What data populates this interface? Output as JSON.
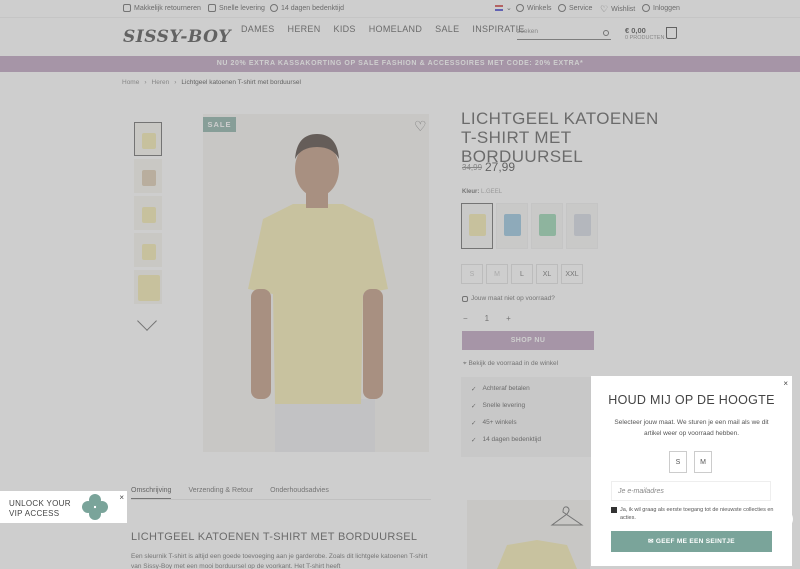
{
  "topbar": {
    "returns": "Makkelijk retourneren",
    "delivery": "Snelle levering",
    "reflection": "14 dagen bedenktijd",
    "stores": "Winkels",
    "service": "Service",
    "wishlist": "Wishlist",
    "login": "Inloggen"
  },
  "header": {
    "logo": "SISSY-BOY",
    "nav": [
      "DAMES",
      "HEREN",
      "KIDS",
      "HOMELAND",
      "SALE",
      "INSPIRATIE"
    ],
    "search_placeholder": "zoeken",
    "cart_price": "€ 0,00",
    "cart_sub": "0 PRODUCTEN"
  },
  "banner": "NU 20% EXTRA KASSAKORTING OP SALE FASHION & ACCESSOIRES MET CODE: 20% EXTRA*",
  "breadcrumb": [
    "Home",
    "Heren",
    "Lichtgeel katoenen T-shirt met borduursel"
  ],
  "product": {
    "sale_badge": "SALE",
    "title": "LICHTGEEL KATOENEN T-SHIRT MET BORDUURSEL",
    "old_price": "34,99",
    "new_price": "27,99",
    "color_label": "Kleur:",
    "color_value": "L.GEEL",
    "swatch_colors": [
      "#f1e7a2",
      "#86bcd9",
      "#86cfa4",
      "#cfd3df"
    ],
    "sizes": [
      {
        "label": "S",
        "available": false
      },
      {
        "label": "M",
        "available": false
      },
      {
        "label": "L",
        "available": true
      },
      {
        "label": "XL",
        "available": true
      },
      {
        "label": "XXL",
        "available": true
      }
    ],
    "notify": "Jouw maat niet op voorraad?",
    "qty": "1",
    "qty_minus": "−",
    "qty_plus": "+",
    "shop_button": "SHOP NU",
    "stock_link": "Bekijk de voorraad in de winkel",
    "usps": [
      "Achteraf betalen",
      "Snelle levering",
      "45+ winkels",
      "14 dagen bedenktijd"
    ]
  },
  "tabs": [
    "Omschrijving",
    "Verzending & Retour",
    "Onderhoudsadvies"
  ],
  "description": {
    "title": "LICHTGEEL KATOENEN T-SHIRT MET BORDUURSEL",
    "text": "Een sleurnik T-shirt is altijd een goede toevoeging aan je garderobe. Zoals dit lichtgele katoenen T-shirt van Sissy-Boy met een mooi borduursel op de voorkant. Het T-shirt heeft"
  },
  "popup": {
    "close": "×",
    "title": "HOUD MIJ OP DE HOOGTE",
    "text": "Selecteer jouw maat. We sturen je een mail als we dit artikel weer op voorraad hebben.",
    "sizes": [
      "S",
      "M"
    ],
    "email_placeholder": "Je e-mailadres",
    "consent": "Ja, ik wil graag als eerste toegang tot de nieuwste collecties en acties.",
    "submit": "GEEF ME EEN SEINTJE"
  },
  "vip": {
    "text": "UNLOCK YOUR VIP ACCESS",
    "close": "×"
  },
  "colors": {
    "accent_purple": "#b394b5",
    "accent_green": "#7aa49a",
    "overlay": "rgba(150,150,150,0.47)"
  }
}
